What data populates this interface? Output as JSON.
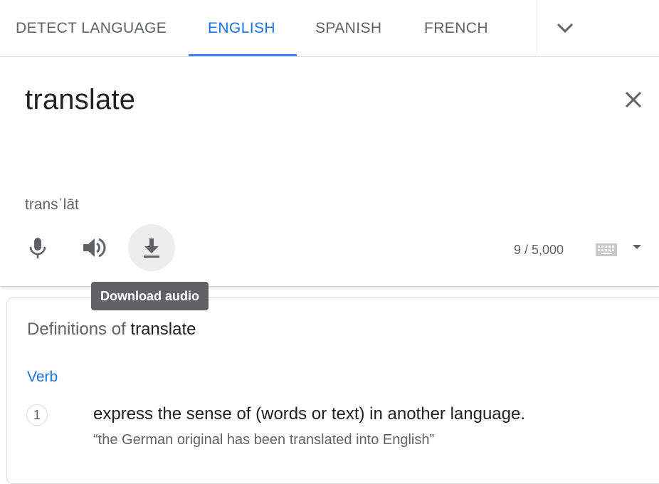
{
  "tabs": {
    "items": [
      {
        "label": "DETECT LANGUAGE"
      },
      {
        "label": "ENGLISH"
      },
      {
        "label": "SPANISH"
      },
      {
        "label": "FRENCH"
      }
    ],
    "active_index": 1,
    "more_icon": "chevron-down-icon"
  },
  "source": {
    "text": "translate",
    "phonetic": "transˈlāt",
    "char_count": "9 / 5,000",
    "icons": [
      "microphone-icon",
      "speaker-icon",
      "download-icon",
      "close-icon",
      "keyboard-icon",
      "caret-down-icon"
    ]
  },
  "tooltip": {
    "text": "Download audio"
  },
  "definitions": {
    "title_prefix": "Definitions of",
    "title_word": "translate",
    "part_of_speech": "Verb",
    "entries": [
      {
        "number": "1",
        "meaning": "express the sense of (words or text) in another language.",
        "example": "“the German original has been translated into English”"
      }
    ]
  },
  "colors": {
    "accent": "#1a73e8",
    "tooltip_bg": "#5f6368",
    "text_primary": "#202124",
    "text_secondary": "#5f6368"
  }
}
